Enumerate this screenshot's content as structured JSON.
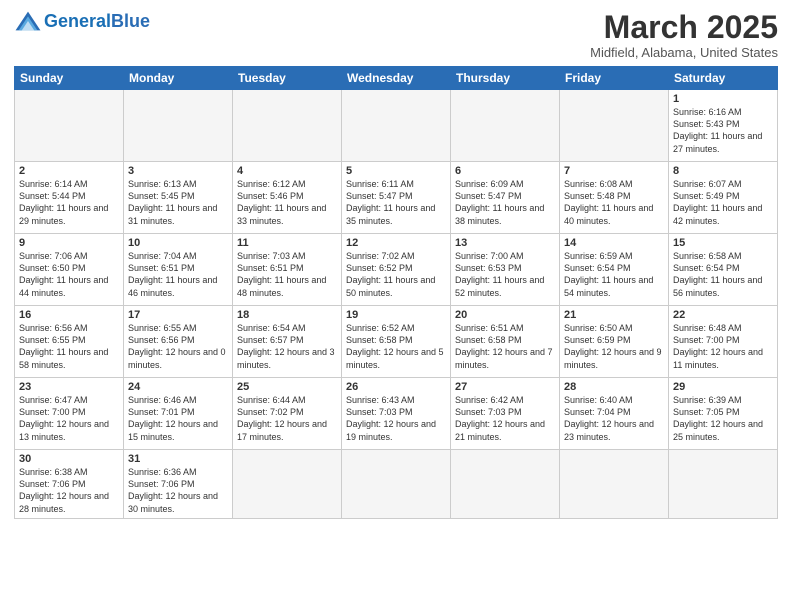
{
  "logo": {
    "text_general": "General",
    "text_blue": "Blue"
  },
  "title": "March 2025",
  "location": "Midfield, Alabama, United States",
  "weekdays": [
    "Sunday",
    "Monday",
    "Tuesday",
    "Wednesday",
    "Thursday",
    "Friday",
    "Saturday"
  ],
  "weeks": [
    [
      {
        "day": "",
        "info": ""
      },
      {
        "day": "",
        "info": ""
      },
      {
        "day": "",
        "info": ""
      },
      {
        "day": "",
        "info": ""
      },
      {
        "day": "",
        "info": ""
      },
      {
        "day": "",
        "info": ""
      },
      {
        "day": "1",
        "info": "Sunrise: 6:16 AM\nSunset: 5:43 PM\nDaylight: 11 hours\nand 27 minutes."
      }
    ],
    [
      {
        "day": "2",
        "info": "Sunrise: 6:14 AM\nSunset: 5:44 PM\nDaylight: 11 hours\nand 29 minutes."
      },
      {
        "day": "3",
        "info": "Sunrise: 6:13 AM\nSunset: 5:45 PM\nDaylight: 11 hours\nand 31 minutes."
      },
      {
        "day": "4",
        "info": "Sunrise: 6:12 AM\nSunset: 5:46 PM\nDaylight: 11 hours\nand 33 minutes."
      },
      {
        "day": "5",
        "info": "Sunrise: 6:11 AM\nSunset: 5:47 PM\nDaylight: 11 hours\nand 35 minutes."
      },
      {
        "day": "6",
        "info": "Sunrise: 6:09 AM\nSunset: 5:47 PM\nDaylight: 11 hours\nand 38 minutes."
      },
      {
        "day": "7",
        "info": "Sunrise: 6:08 AM\nSunset: 5:48 PM\nDaylight: 11 hours\nand 40 minutes."
      },
      {
        "day": "8",
        "info": "Sunrise: 6:07 AM\nSunset: 5:49 PM\nDaylight: 11 hours\nand 42 minutes."
      }
    ],
    [
      {
        "day": "9",
        "info": "Sunrise: 7:06 AM\nSunset: 6:50 PM\nDaylight: 11 hours\nand 44 minutes."
      },
      {
        "day": "10",
        "info": "Sunrise: 7:04 AM\nSunset: 6:51 PM\nDaylight: 11 hours\nand 46 minutes."
      },
      {
        "day": "11",
        "info": "Sunrise: 7:03 AM\nSunset: 6:51 PM\nDaylight: 11 hours\nand 48 minutes."
      },
      {
        "day": "12",
        "info": "Sunrise: 7:02 AM\nSunset: 6:52 PM\nDaylight: 11 hours\nand 50 minutes."
      },
      {
        "day": "13",
        "info": "Sunrise: 7:00 AM\nSunset: 6:53 PM\nDaylight: 11 hours\nand 52 minutes."
      },
      {
        "day": "14",
        "info": "Sunrise: 6:59 AM\nSunset: 6:54 PM\nDaylight: 11 hours\nand 54 minutes."
      },
      {
        "day": "15",
        "info": "Sunrise: 6:58 AM\nSunset: 6:54 PM\nDaylight: 11 hours\nand 56 minutes."
      }
    ],
    [
      {
        "day": "16",
        "info": "Sunrise: 6:56 AM\nSunset: 6:55 PM\nDaylight: 11 hours\nand 58 minutes."
      },
      {
        "day": "17",
        "info": "Sunrise: 6:55 AM\nSunset: 6:56 PM\nDaylight: 12 hours\nand 0 minutes."
      },
      {
        "day": "18",
        "info": "Sunrise: 6:54 AM\nSunset: 6:57 PM\nDaylight: 12 hours\nand 3 minutes."
      },
      {
        "day": "19",
        "info": "Sunrise: 6:52 AM\nSunset: 6:58 PM\nDaylight: 12 hours\nand 5 minutes."
      },
      {
        "day": "20",
        "info": "Sunrise: 6:51 AM\nSunset: 6:58 PM\nDaylight: 12 hours\nand 7 minutes."
      },
      {
        "day": "21",
        "info": "Sunrise: 6:50 AM\nSunset: 6:59 PM\nDaylight: 12 hours\nand 9 minutes."
      },
      {
        "day": "22",
        "info": "Sunrise: 6:48 AM\nSunset: 7:00 PM\nDaylight: 12 hours\nand 11 minutes."
      }
    ],
    [
      {
        "day": "23",
        "info": "Sunrise: 6:47 AM\nSunset: 7:00 PM\nDaylight: 12 hours\nand 13 minutes."
      },
      {
        "day": "24",
        "info": "Sunrise: 6:46 AM\nSunset: 7:01 PM\nDaylight: 12 hours\nand 15 minutes."
      },
      {
        "day": "25",
        "info": "Sunrise: 6:44 AM\nSunset: 7:02 PM\nDaylight: 12 hours\nand 17 minutes."
      },
      {
        "day": "26",
        "info": "Sunrise: 6:43 AM\nSunset: 7:03 PM\nDaylight: 12 hours\nand 19 minutes."
      },
      {
        "day": "27",
        "info": "Sunrise: 6:42 AM\nSunset: 7:03 PM\nDaylight: 12 hours\nand 21 minutes."
      },
      {
        "day": "28",
        "info": "Sunrise: 6:40 AM\nSunset: 7:04 PM\nDaylight: 12 hours\nand 23 minutes."
      },
      {
        "day": "29",
        "info": "Sunrise: 6:39 AM\nSunset: 7:05 PM\nDaylight: 12 hours\nand 25 minutes."
      }
    ],
    [
      {
        "day": "30",
        "info": "Sunrise: 6:38 AM\nSunset: 7:06 PM\nDaylight: 12 hours\nand 28 minutes."
      },
      {
        "day": "31",
        "info": "Sunrise: 6:36 AM\nSunset: 7:06 PM\nDaylight: 12 hours\nand 30 minutes."
      },
      {
        "day": "",
        "info": ""
      },
      {
        "day": "",
        "info": ""
      },
      {
        "day": "",
        "info": ""
      },
      {
        "day": "",
        "info": ""
      },
      {
        "day": "",
        "info": ""
      }
    ]
  ]
}
